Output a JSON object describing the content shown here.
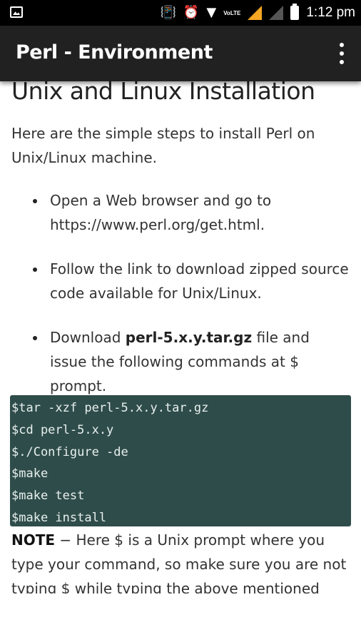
{
  "status_bar": {
    "time": "1:12 pm",
    "network_label": "VoLTE",
    "icons": [
      "image-notification-icon",
      "vibrate-icon",
      "alarm-icon",
      "wifi-icon",
      "signal-icon",
      "no-signal-icon",
      "battery-icon"
    ]
  },
  "app_bar": {
    "title": "Perl - Environment",
    "menu_icon": "more-vertical-icon"
  },
  "article": {
    "heading": "Unix and Linux Installation",
    "intro": "Here are the simple steps to install Perl on Unix/Linux machine.",
    "steps": [
      {
        "text": "Open a Web browser and go to https://www.perl.org/get.html."
      },
      {
        "text": "Follow the link to download zipped source code available for Unix/Linux."
      },
      {
        "before": "Download ",
        "bold": "perl-5.x.y.tar.gz",
        "after": " file and issue the following commands at $ prompt."
      }
    ],
    "code_lines": [
      "$tar -xzf perl-5.x.y.tar.gz",
      "$cd perl-5.x.y",
      "$./Configure -de",
      "$make",
      "$make test",
      "$make install"
    ],
    "note": {
      "label": "NOTE",
      "text": " − Here $ is a Unix prompt where you type your command, so make sure you are not typing $ while typing the above mentioned"
    }
  }
}
